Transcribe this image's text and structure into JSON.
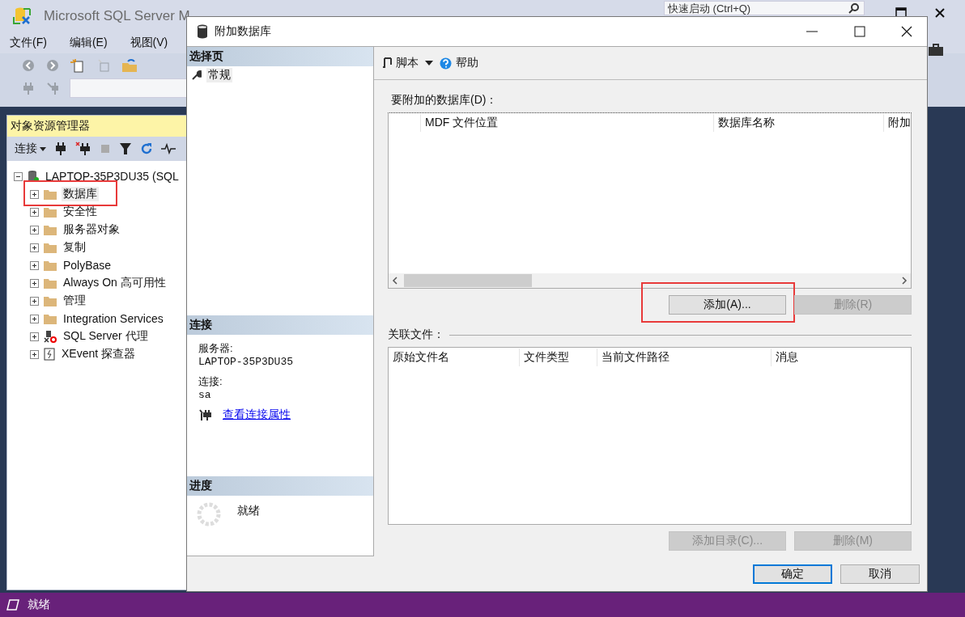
{
  "main_window": {
    "title": "Microsoft SQL Server M",
    "quick_launch": {
      "placeholder": "快速启动 (Ctrl+Q)"
    },
    "menu": [
      "文件(F)",
      "编辑(E)",
      "视图(V)"
    ]
  },
  "object_explorer": {
    "title": "对象资源管理器",
    "connect_label": "连接",
    "root": {
      "label": "LAPTOP-35P3DU35 (SQL",
      "expanded": true,
      "children": [
        {
          "label": "数据库",
          "kind": "folder",
          "highlighted": true,
          "selected": true
        },
        {
          "label": "安全性",
          "kind": "folder",
          "highlighted": false,
          "selected": false
        },
        {
          "label": "服务器对象",
          "kind": "folder",
          "highlighted": false,
          "selected": false
        },
        {
          "label": "复制",
          "kind": "folder",
          "highlighted": false,
          "selected": false
        },
        {
          "label": "PolyBase",
          "kind": "folder",
          "highlighted": false,
          "selected": false
        },
        {
          "label": "Always On 高可用性",
          "kind": "folder",
          "highlighted": false,
          "selected": false
        },
        {
          "label": "管理",
          "kind": "folder",
          "highlighted": false,
          "selected": false
        },
        {
          "label": "Integration Services",
          "kind": "folder",
          "highlighted": false,
          "selected": false
        },
        {
          "label": "SQL Server 代理",
          "kind": "agent",
          "highlighted": false,
          "selected": false
        },
        {
          "label": "XEvent 探查器",
          "kind": "xevent",
          "highlighted": false,
          "selected": false
        }
      ]
    }
  },
  "dialog": {
    "title": "附加数据库",
    "select_page": {
      "heading": "选择页",
      "items": [
        {
          "label": "常规",
          "selected": true
        }
      ]
    },
    "connection": {
      "heading": "连接",
      "server_label": "服务器:",
      "server": "LAPTOP-35P3DU35",
      "login_label": "连接:",
      "login": "sa",
      "link": "查看连接属性"
    },
    "progress": {
      "heading": "进度",
      "status": "就绪"
    },
    "toolbar": {
      "script": "脚本",
      "help": "帮助"
    },
    "attach": {
      "label": "要附加的数据库(D)：",
      "columns": [
        "MDF 文件位置",
        "数据库名称",
        "附加"
      ],
      "buttons": [
        {
          "label": "添加(A)...",
          "disabled": false,
          "highlighted": true
        },
        {
          "label": "删除(R)",
          "disabled": true,
          "highlighted": false
        }
      ]
    },
    "related": {
      "label": "关联文件：",
      "columns": [
        "原始文件名",
        "文件类型",
        "当前文件路径",
        "消息"
      ],
      "buttons": [
        {
          "label": "添加目录(C)...",
          "disabled": true
        },
        {
          "label": "删除(M)",
          "disabled": true
        }
      ]
    },
    "footer_buttons": [
      {
        "label": "确定",
        "default": true
      },
      {
        "label": "取消",
        "default": false
      }
    ]
  },
  "status_bar": {
    "text": "就绪"
  }
}
